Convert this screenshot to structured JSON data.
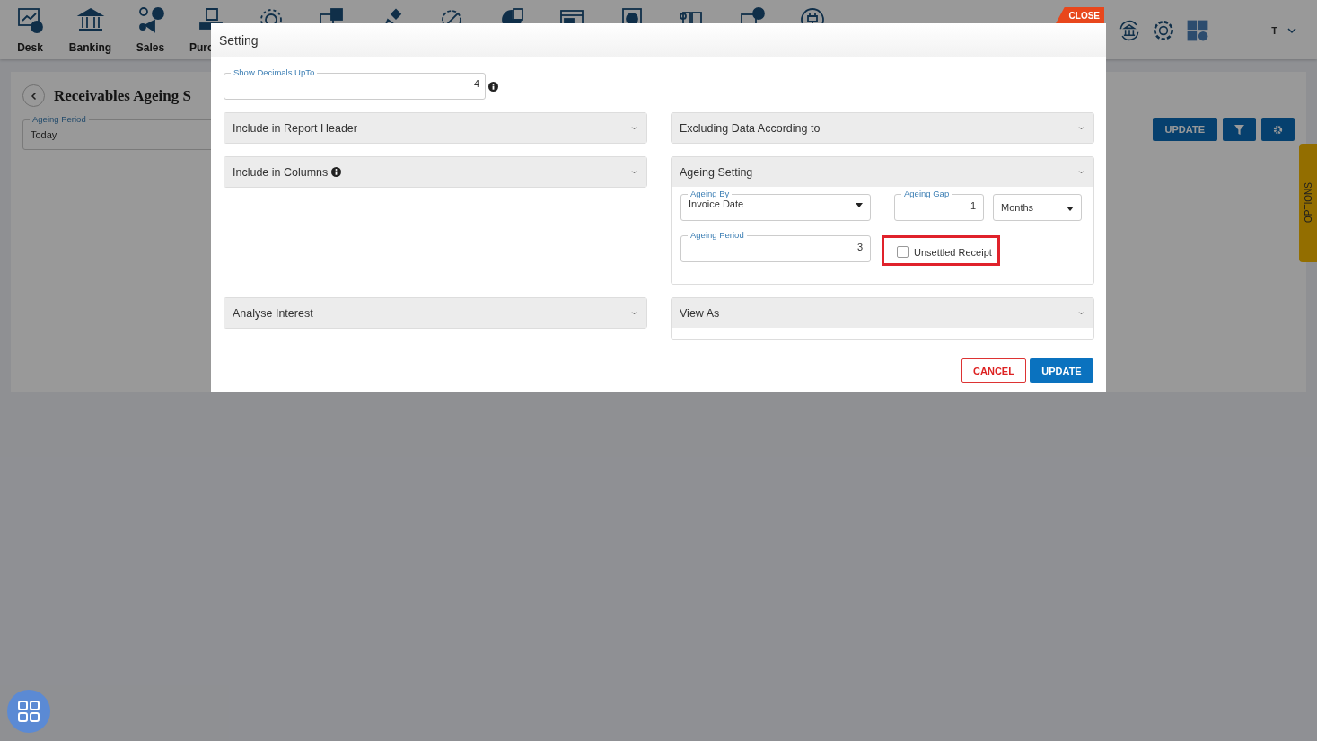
{
  "nav": {
    "labels": [
      "Desk",
      "Banking",
      "Sales",
      "Purc"
    ]
  },
  "close_tab": "CLOSE",
  "user": {
    "initial": "T"
  },
  "report": {
    "title": "Receivables Ageing S",
    "ageing_period": {
      "label": "Ageing Period",
      "value": "Today"
    },
    "update_button": "UPDATE",
    "options_tab": "OPTIONS"
  },
  "dialog": {
    "title": "Setting",
    "decimals": {
      "label": "Show Decimals UpTo",
      "value": "4"
    },
    "sections": [
      {
        "title": "Include in Report Header",
        "expanded": false,
        "info": false
      },
      {
        "title": "Excluding Data According to",
        "expanded": false,
        "info": false
      },
      {
        "title": "Include in Columns",
        "expanded": false,
        "info": true
      },
      {
        "title": "Ageing Setting",
        "expanded": true,
        "info": false,
        "fields": [
          {
            "kind": "select",
            "label": "Ageing By",
            "value": "Invoice Date"
          },
          {
            "kind": "number",
            "label": "Ageing Gap",
            "value": "1"
          },
          {
            "kind": "select",
            "value": "Months"
          },
          {
            "kind": "number",
            "label": "Ageing Period",
            "value": "3"
          },
          {
            "kind": "checkbox",
            "label": "Unsettled Receipt",
            "checked": false,
            "highlighted": true
          }
        ]
      },
      {
        "title": "Analyse Interest",
        "expanded": false,
        "info": false
      },
      {
        "title": "View As",
        "expanded": true,
        "info": false
      }
    ],
    "buttons": [
      {
        "label": "CANCEL",
        "kind": "secondary"
      },
      {
        "label": "UPDATE",
        "kind": "primary"
      }
    ]
  }
}
